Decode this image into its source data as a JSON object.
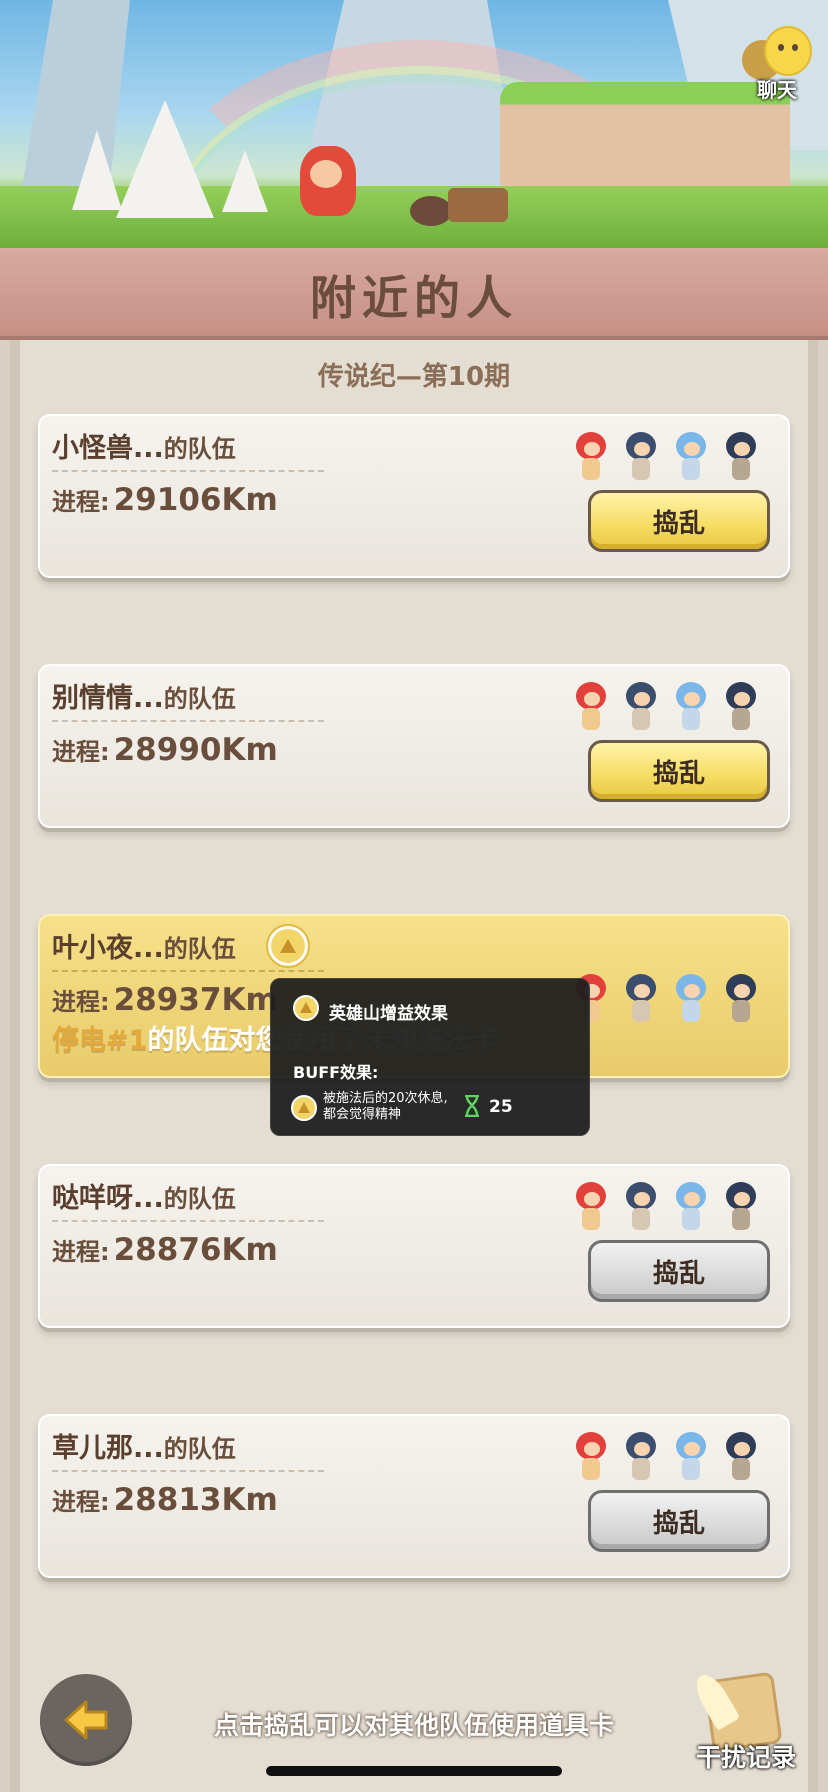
{
  "header": {
    "chat_label": "聊天",
    "title": "附近的人"
  },
  "season": "传说纪—第10期",
  "cards": [
    {
      "name": "小怪兽...",
      "suffix": "的队伍",
      "progress_label": "进程:",
      "progress_value": "29106Km",
      "button": "捣乱",
      "button_state": "active"
    },
    {
      "name": "别情情...",
      "suffix": "的队伍",
      "progress_label": "进程:",
      "progress_value": "28990Km",
      "button": "捣乱",
      "button_state": "active"
    },
    {
      "name": "叶小夜...",
      "suffix": "的队伍",
      "progress_label": "进程:",
      "progress_value": "28937Km",
      "has_buff_icon": true,
      "highlight": true,
      "notice": {
        "who": "停电#1",
        "text": "的队伍对您使用了未知施法卡"
      }
    },
    {
      "name": "哒咩呀...",
      "suffix": "的队伍",
      "progress_label": "进程:",
      "progress_value": "28876Km",
      "button": "捣乱",
      "button_state": "disabled"
    },
    {
      "name": "草儿那...",
      "suffix": "的队伍",
      "progress_label": "进程:",
      "progress_value": "28813Km",
      "button": "捣乱",
      "button_state": "disabled"
    }
  ],
  "tooltip": {
    "title": "英雄山增益效果",
    "buff_label": "BUFF效果:",
    "description": "被施法后的20次休息,都会觉得精神",
    "count": "25"
  },
  "footer": {
    "hint": "点击捣乱可以对其他队伍使用道具卡",
    "record_label": "干扰记录"
  },
  "colors": {
    "highlight_card": "#f0d77a",
    "active_button": "#f5dc62",
    "disabled_button": "#d9d9d9",
    "banner": "#d2a196"
  }
}
